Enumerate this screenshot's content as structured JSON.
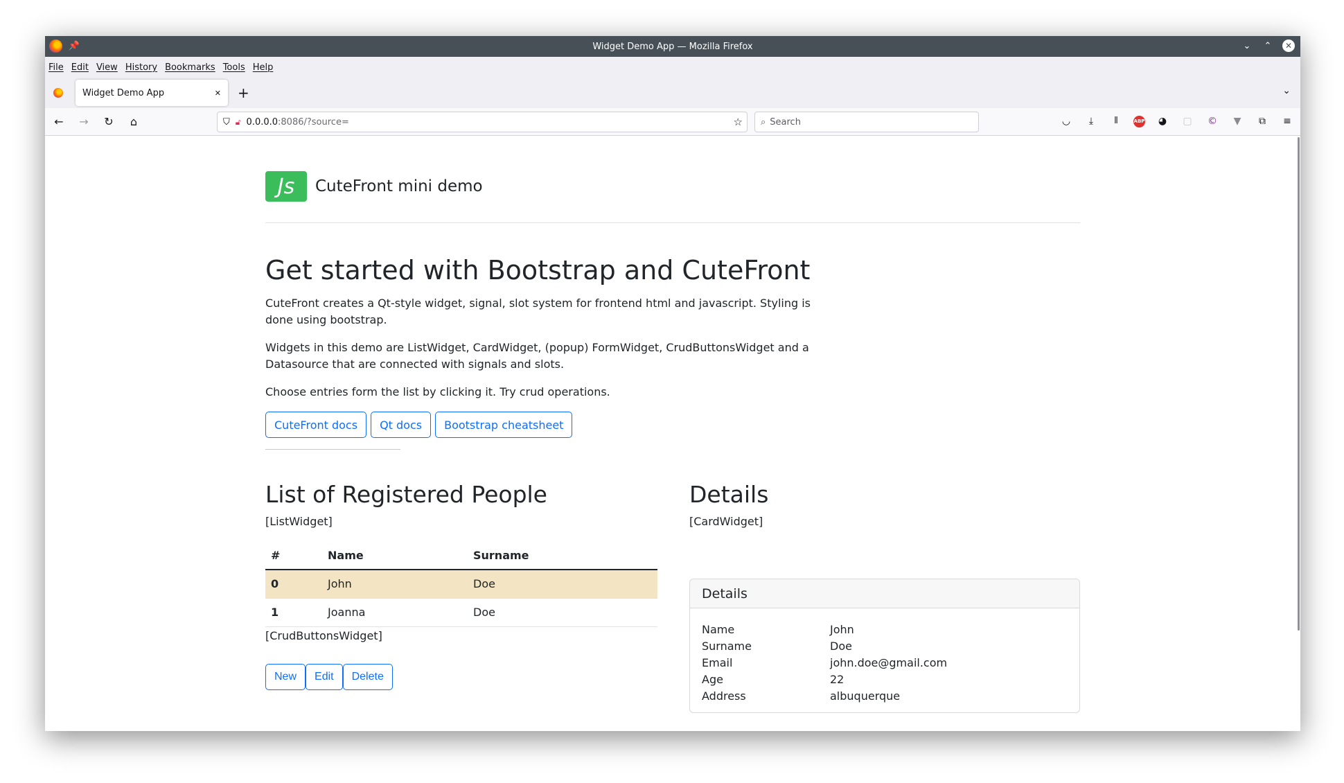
{
  "window": {
    "title": "Widget Demo App — Mozilla Firefox"
  },
  "menu": [
    "File",
    "Edit",
    "View",
    "History",
    "Bookmarks",
    "Tools",
    "Help"
  ],
  "tab": {
    "title": "Widget Demo App",
    "close": "✕"
  },
  "url": {
    "host": "0.0.0.0",
    "path": ":8086/?source="
  },
  "search": {
    "placeholder": "Search"
  },
  "page": {
    "brand": "CuteFront mini demo",
    "logo_text": "Js",
    "heading": "Get started with Bootstrap and CuteFront",
    "para1": "CuteFront creates a Qt-style widget, signal, slot system for frontend html and javascript. Styling is done using bootstrap.",
    "para2": "Widgets in this demo are ListWidget, CardWidget, (popup) FormWidget, CrudButtonsWidget and a Datasource that are connected with signals and slots.",
    "para3": "Choose entries form the list by clicking it. Try crud operations.",
    "links": [
      "CuteFront docs",
      "Qt docs",
      "Bootstrap cheatsheet"
    ]
  },
  "list": {
    "heading": "List of Registered People",
    "widget_tag": "[ListWidget]",
    "columns": [
      "#",
      "Name",
      "Surname"
    ],
    "rows": [
      {
        "num": "0",
        "name": "John",
        "surname": "Doe",
        "active": true
      },
      {
        "num": "1",
        "name": "Joanna",
        "surname": "Doe",
        "active": false
      }
    ],
    "crud_tag": "[CrudButtonsWidget]",
    "crud_buttons": [
      "New",
      "Edit",
      "Delete"
    ]
  },
  "details": {
    "heading": "Details",
    "widget_tag": "[CardWidget]",
    "card_title": "Details",
    "fields": [
      {
        "key": "Name",
        "value": "John"
      },
      {
        "key": "Surname",
        "value": "Doe"
      },
      {
        "key": "Email",
        "value": "john.doe@gmail.com"
      },
      {
        "key": "Age",
        "value": "22"
      },
      {
        "key": "Address",
        "value": "albuquerque"
      }
    ]
  }
}
